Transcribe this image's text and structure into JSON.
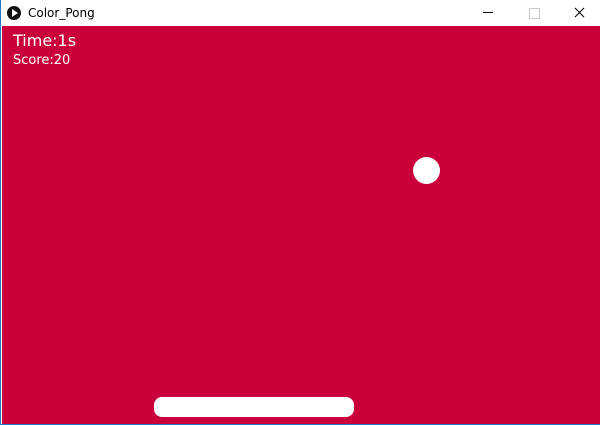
{
  "window": {
    "title": "Color_Pong",
    "app_icon": "play-circle-icon",
    "controls": {
      "minimize_icon": "minimize-icon",
      "maximize_icon": "maximize-icon",
      "close_icon": "close-icon"
    }
  },
  "game": {
    "background_color": "#c9003a",
    "foreground_color": "#ffffff",
    "hud": {
      "time": "Time:1s",
      "score": "Score:20"
    }
  }
}
